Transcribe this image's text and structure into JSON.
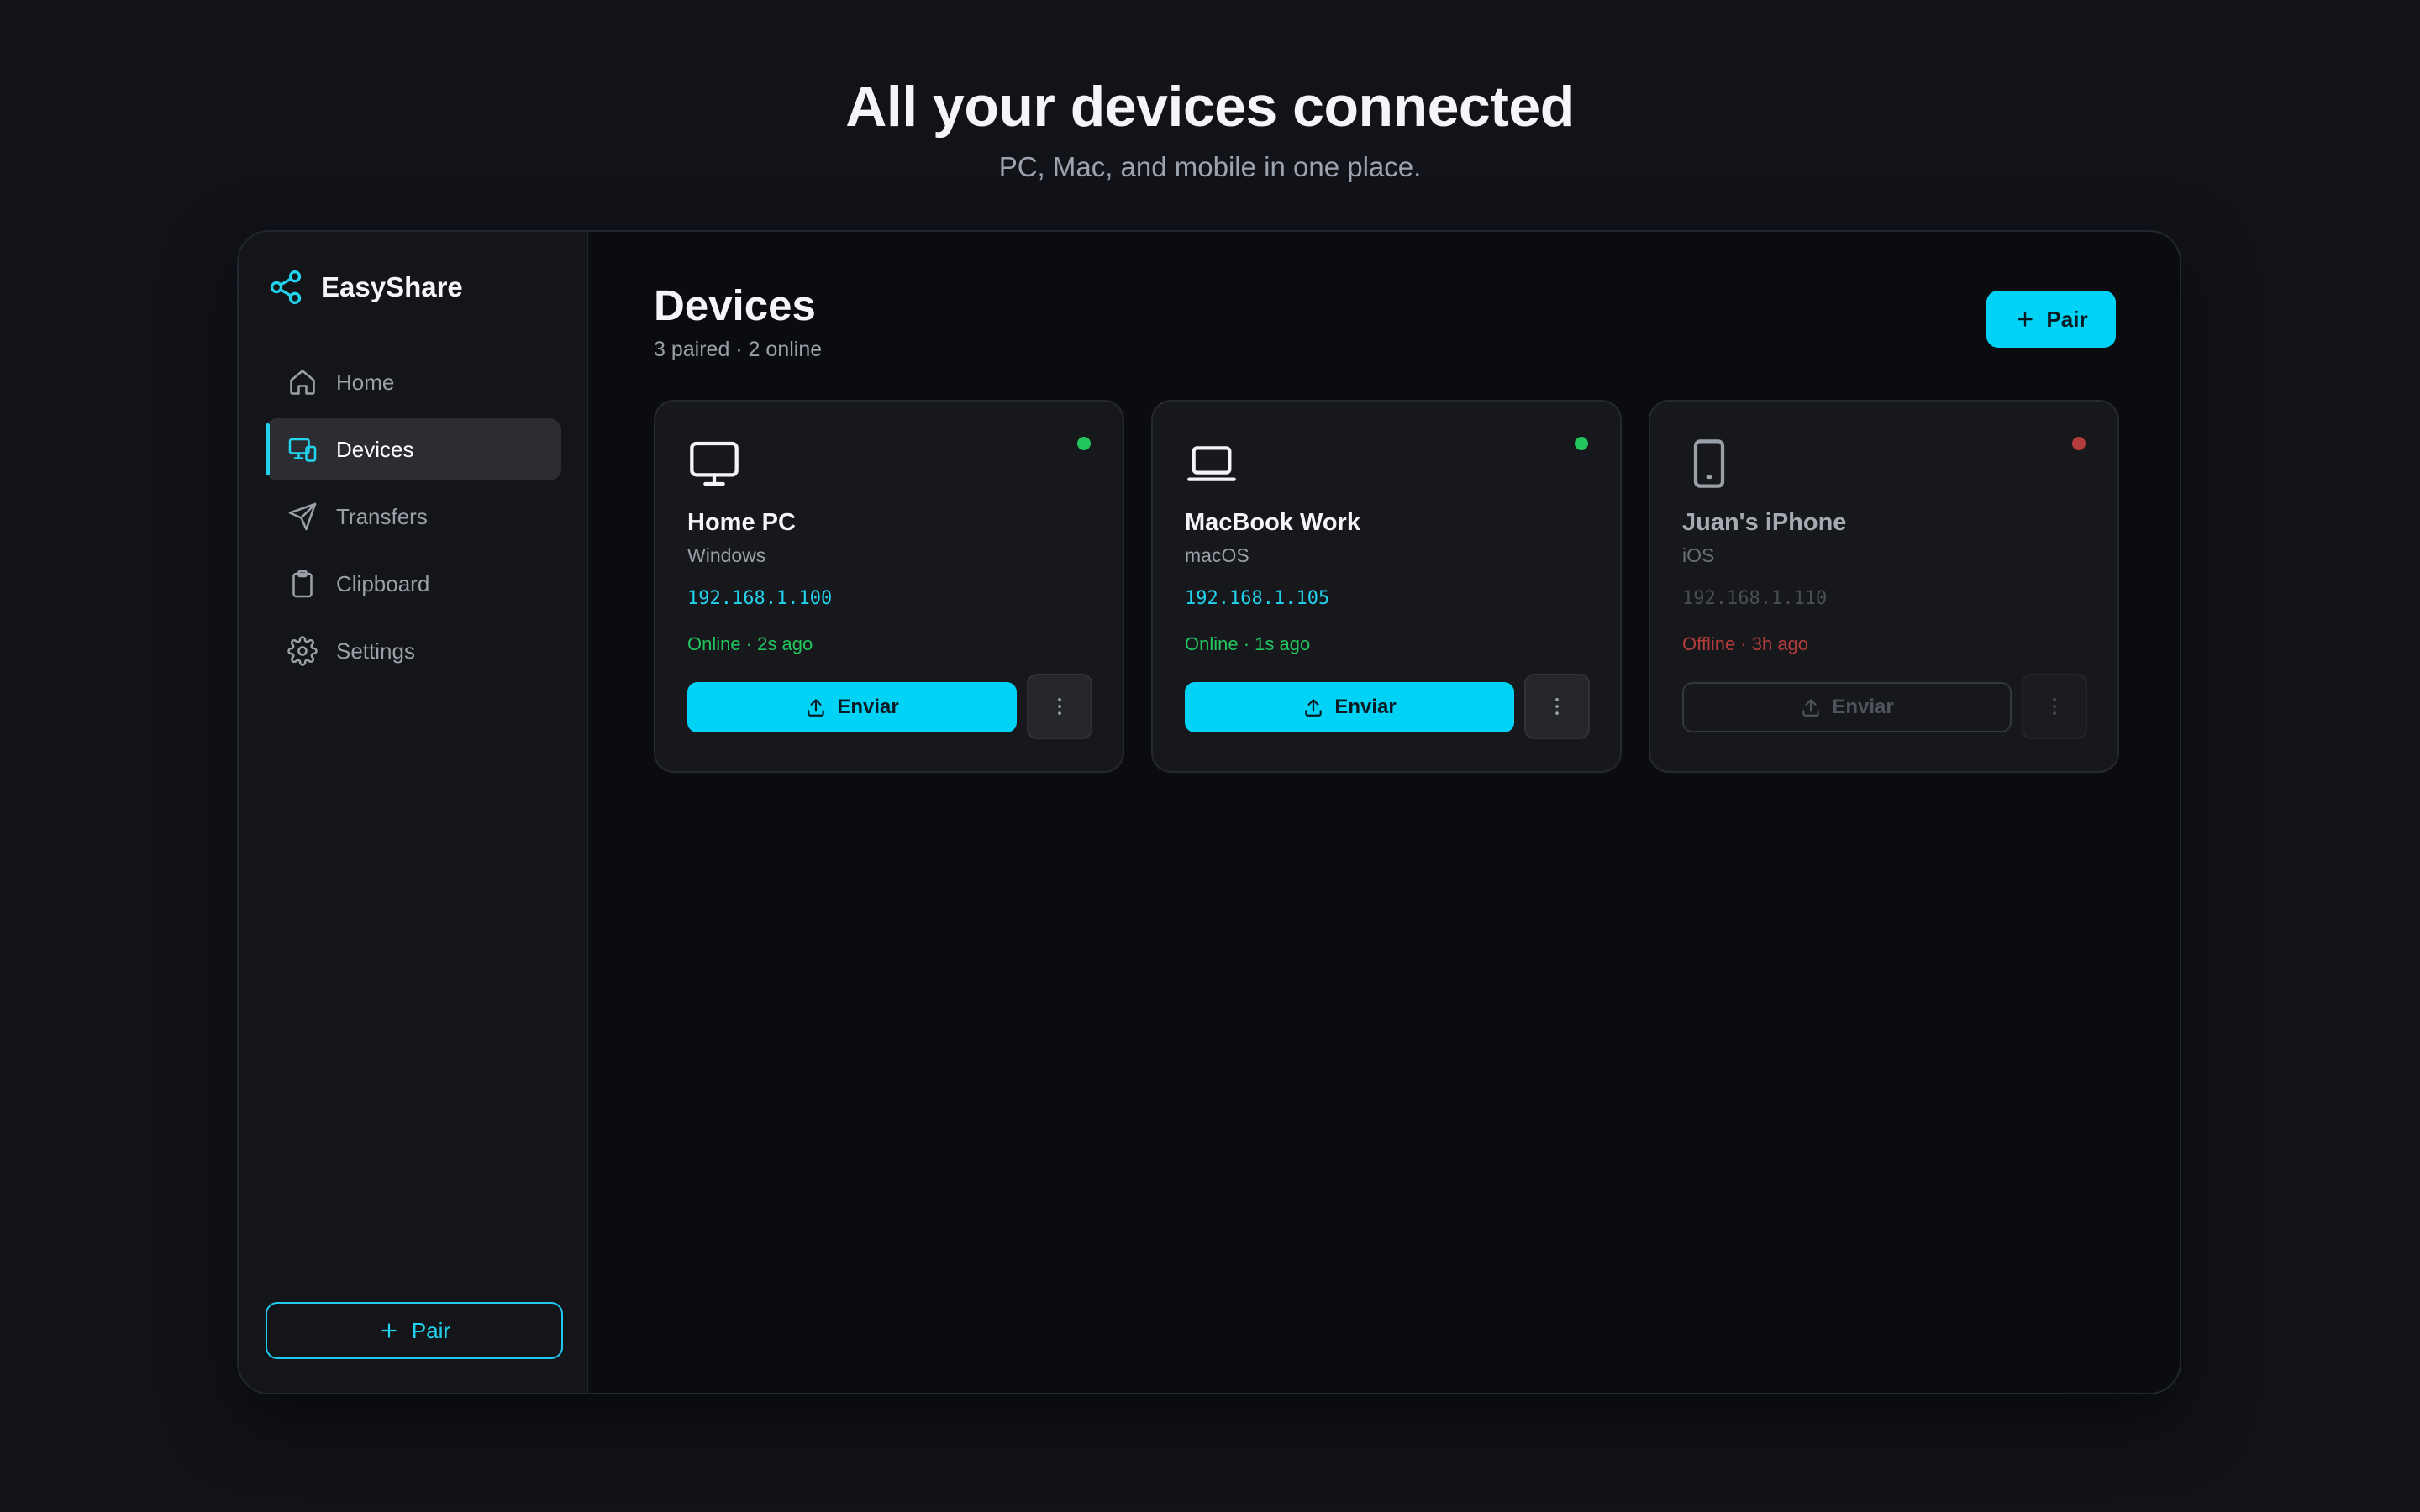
{
  "hero": {
    "title": "All your devices connected",
    "subtitle": "PC, Mac, and mobile in one place."
  },
  "app": {
    "name": "EasyShare",
    "brand_icon": "share-icon",
    "accent_color": "#00d3f5"
  },
  "sidebar": {
    "items": [
      {
        "label": "Home",
        "icon": "home-icon",
        "active": false
      },
      {
        "label": "Devices",
        "icon": "devices-icon",
        "active": true
      },
      {
        "label": "Transfers",
        "icon": "send-icon",
        "active": false
      },
      {
        "label": "Clipboard",
        "icon": "clipboard-icon",
        "active": false
      },
      {
        "label": "Settings",
        "icon": "gear-icon",
        "active": false
      }
    ],
    "pair_label": "Pair"
  },
  "main": {
    "title": "Devices",
    "subtitle": "3 paired · 2 online",
    "pair_label": "Pair",
    "devices": [
      {
        "name": "Home PC",
        "os": "Windows",
        "ip": "192.168.1.100",
        "status": "Online · 2s ago",
        "online": true,
        "icon": "monitor-icon",
        "send_label": "Enviar",
        "status_color": "#22c55e"
      },
      {
        "name": "MacBook Work",
        "os": "macOS",
        "ip": "192.168.1.105",
        "status": "Online · 1s ago",
        "online": true,
        "icon": "laptop-icon",
        "send_label": "Enviar",
        "status_color": "#22c55e"
      },
      {
        "name": "Juan's iPhone",
        "os": "iOS",
        "ip": "192.168.1.110",
        "status": "Offline · 3h ago",
        "online": false,
        "icon": "phone-icon",
        "send_label": "Enviar",
        "status_color": "#b43c3c"
      }
    ]
  }
}
